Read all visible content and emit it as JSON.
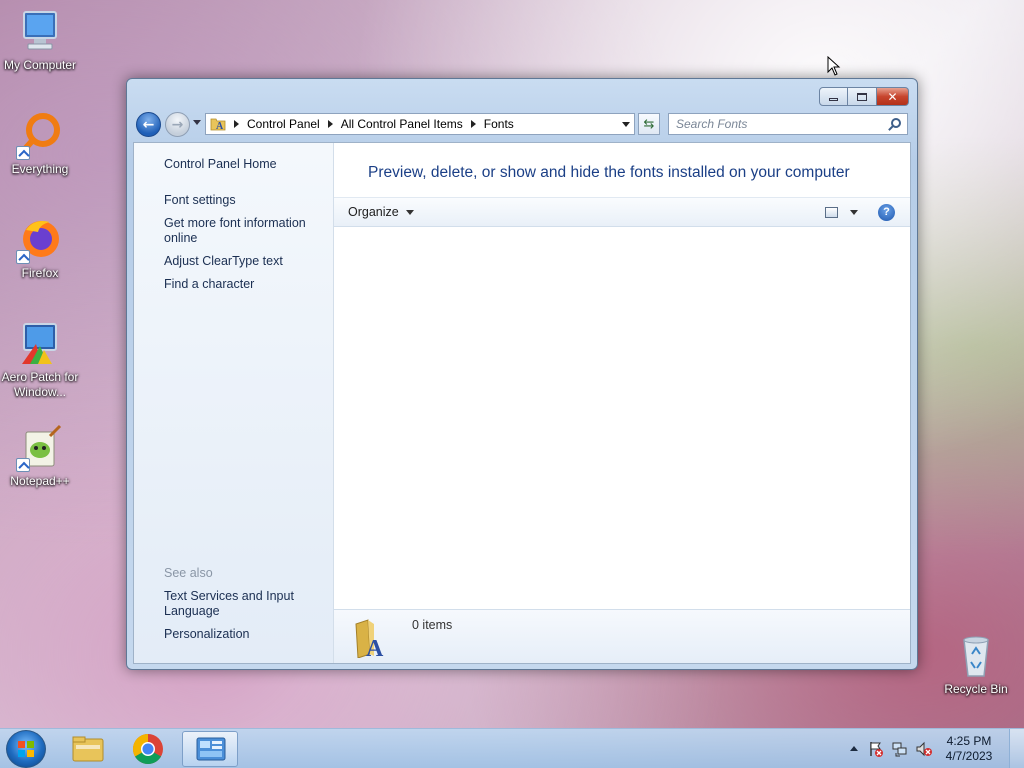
{
  "desktop": {
    "icons": [
      {
        "label": "My Computer"
      },
      {
        "label": "Everything"
      },
      {
        "label": "Firefox"
      },
      {
        "label": "Aero Patch for Window..."
      },
      {
        "label": "Notepad++"
      },
      {
        "label": "Recycle Bin"
      }
    ]
  },
  "window": {
    "address": {
      "crumbs": [
        "Control Panel",
        "All Control Panel Items",
        "Fonts"
      ]
    },
    "search": {
      "placeholder": "Search Fonts"
    },
    "left_pane": {
      "home": "Control Panel Home",
      "links": [
        "Font settings",
        "Get more font information online",
        "Adjust ClearType text",
        "Find a character"
      ],
      "see_also_label": "See also",
      "see_also": [
        "Text Services and Input Language",
        "Personalization"
      ]
    },
    "heading": "Preview, delete, or show and hide the fonts installed on your computer",
    "toolbar": {
      "organize": "Organize"
    },
    "status": {
      "items": "0 items"
    }
  },
  "taskbar": {
    "clock": {
      "time": "4:25 PM",
      "date": "4/7/2023"
    }
  },
  "icons": {
    "back": "arrow-left-icon",
    "forward": "arrow-right-icon",
    "refresh": "refresh-icon",
    "search": "search-icon",
    "help": "help-icon",
    "close": "close-icon",
    "minimize": "minimize-icon",
    "maximize": "maximize-icon"
  },
  "colors": {
    "link": "#1b2f52",
    "heading": "#1b3f86",
    "close_button": "#c7452e"
  }
}
